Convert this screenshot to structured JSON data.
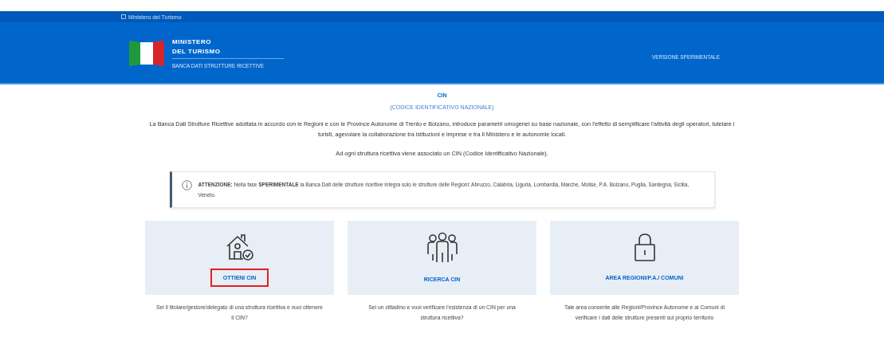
{
  "top_bar": {
    "label": "Ministero del Turismo"
  },
  "header": {
    "title_lines": [
      "MINISTERO",
      "DEL TURISMO"
    ],
    "subtitle": "BANCA DATI STRUTTURE RICETTIVE",
    "version": "VERSIONE SPERIMENTALE"
  },
  "intro": {
    "title": "CIN",
    "subtitle": "(CODICE IDENTIFICATIVO NAZIONALE)",
    "paragraphs": [
      "La Banca Dati Strutture Ricettive adottata in accordo con le Regioni e con le Province Autonome di Trento e Bolzano, introduce parametri omogenei su base nazionale, con l'effetto di semplificare l'attività degli operatori, tutelare i turisti, agevolare la collaborazione tra istituzioni e imprese e tra il Ministero e le autonomie locali.",
      "Ad ogni struttura ricettiva viene associato un CIN (Codice Identificativo Nazionale)."
    ]
  },
  "notice": {
    "text": "**ATTENZIONE:** Nella fase **SPERIMENTALE** la Banca Dati delle strutture ricettive integra solo le strutture delle Regioni: Abruzzo, Calabria, Liguria, Lombardia, Marche, Molise, P.A. Bolzano, Puglia, Sardegna, Sicilia, Veneto."
  },
  "cards": [
    {
      "kind": "house",
      "label": "OTTIENI CIN",
      "highlighted": true,
      "description": "Sei il titolare/gestore/delegato di una struttura ricettiva e vuoi ottenere il CIN?"
    },
    {
      "kind": "people",
      "label": "RICERCA CIN",
      "highlighted": false,
      "description": "Sei un cittadino e vuoi verificare l'esistenza di un CIN per una struttura ricettiva?"
    },
    {
      "kind": "lock",
      "label": "AREA REGIONI/P.A./ COMUNI",
      "highlighted": false,
      "description": "Tale area consente alle Regioni/Province Autonome e ai Comuni di verificare i dati delle strutture presenti sul proprio territorio"
    }
  ]
}
